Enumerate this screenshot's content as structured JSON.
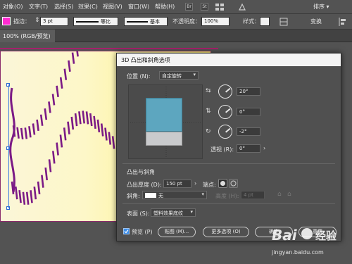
{
  "menu": [
    "对象(O)",
    "文字(T)",
    "选择(S)",
    "效果(C)",
    "视图(V)",
    "窗口(W)",
    "帮助(H)"
  ],
  "toolbar": {
    "stroke_label": "描边：",
    "stroke_value": "3 pt",
    "profile_label": "等比",
    "brush_label": "基本",
    "opacity_label": "不透明度：",
    "opacity_value": "100%",
    "style_label": "样式：",
    "transform_label": "变换"
  },
  "document_tab": "100% (RGB/预览)",
  "dialog": {
    "title": "3D 凸出和斜角选项",
    "position_label": "位置 (N):",
    "position_value": "自定旋转",
    "rot_x": "20°",
    "rot_y": "0°",
    "rot_z": "-2°",
    "perspective_label": "透视 (R):",
    "perspective_value": "0°",
    "extrude_section": "凸出与斜角",
    "extrude_depth_label": "凸出厚度 (D):",
    "extrude_depth_value": "150 pt",
    "cap_label": "端点:",
    "bevel_label": "斜角:",
    "bevel_value": "无",
    "height_label": "高度 (H):",
    "height_value": "4 pt",
    "surface_label": "表面 (S):",
    "surface_value": "塑料效果底纹",
    "preview_label": "预览 (P)",
    "map_art_label": "贴图 (M)...",
    "more_options_label": "更多选项 (O)",
    "ok_label": "确定",
    "reset_label": "重置"
  },
  "watermark": {
    "brand": "Bai",
    "brand2": "经验",
    "url": "jingyan.baidu.com"
  },
  "colors": {
    "artwork_stroke": "#7b1a86",
    "cube_front": "#5da6bf",
    "cube_bottom": "#c9cacc",
    "accent": "#a6206b"
  }
}
